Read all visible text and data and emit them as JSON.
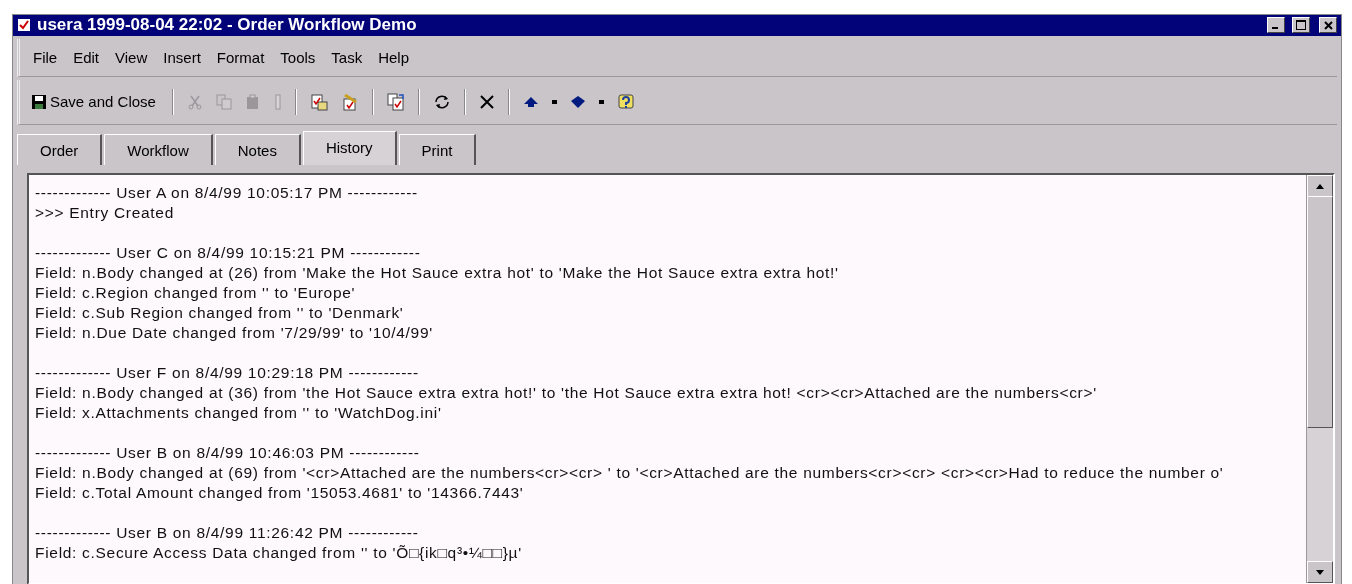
{
  "window": {
    "title": "usera 1999-08-04 22:02 - Order Workflow Demo"
  },
  "menu": [
    "File",
    "Edit",
    "View",
    "Insert",
    "Format",
    "Tools",
    "Task",
    "Help"
  ],
  "toolbar": [
    {
      "kind": "save",
      "label": "Save and Close",
      "disabled": false
    },
    {
      "kind": "sep"
    },
    {
      "kind": "cut",
      "disabled": true
    },
    {
      "kind": "copy",
      "disabled": true
    },
    {
      "kind": "paste",
      "disabled": true
    },
    {
      "kind": "bar",
      "disabled": true
    },
    {
      "kind": "sep"
    },
    {
      "kind": "doc-check",
      "disabled": false
    },
    {
      "kind": "doc-pen",
      "disabled": false
    },
    {
      "kind": "sep"
    },
    {
      "kind": "docs",
      "disabled": false
    },
    {
      "kind": "sep"
    },
    {
      "kind": "refresh",
      "disabled": false
    },
    {
      "kind": "sep"
    },
    {
      "kind": "delete",
      "disabled": false
    },
    {
      "kind": "sep"
    },
    {
      "kind": "up",
      "disabled": false
    },
    {
      "kind": "drop",
      "disabled": false
    },
    {
      "kind": "down",
      "disabled": false
    },
    {
      "kind": "drop",
      "disabled": false
    },
    {
      "kind": "help",
      "disabled": false
    }
  ],
  "tabs": [
    {
      "label": "Order",
      "selected": false
    },
    {
      "label": "Workflow",
      "selected": false
    },
    {
      "label": "Notes",
      "selected": false
    },
    {
      "label": "History",
      "selected": true
    },
    {
      "label": "Print",
      "selected": false
    }
  ],
  "history": [
    {
      "header": "------------- User A on 8/4/99 10:05:17 PM ------------",
      "lines": [
        ">>> Entry Created"
      ]
    },
    {
      "header": "------------- User C on 8/4/99 10:15:21 PM ------------",
      "lines": [
        "Field: n.Body changed at (26) from 'Make the Hot Sauce extra hot' to 'Make the Hot Sauce extra extra hot!'",
        "Field: c.Region changed from '' to 'Europe'",
        "Field: c.Sub Region changed from '' to 'Denmark'",
        "Field: n.Due Date changed from '7/29/99' to '10/4/99'"
      ]
    },
    {
      "header": "------------- User F on 8/4/99 10:29:18 PM ------------",
      "lines": [
        "Field: n.Body changed at (36) from 'the Hot Sauce extra extra hot!' to 'the Hot Sauce extra extra hot! <cr><cr>Attached are the numbers<cr>'",
        "Field: x.Attachments changed from '' to 'WatchDog.ini'"
      ]
    },
    {
      "header": "------------- User B on 8/4/99 10:46:03 PM ------------",
      "lines": [
        "Field: n.Body changed at (69) from '<cr>Attached are the numbers<cr><cr> ' to '<cr>Attached are the numbers<cr><cr> <cr><cr>Had to reduce the number o'",
        "Field: c.Total Amount changed from '15053.4681' to '14366.7443'"
      ]
    },
    {
      "header": "------------- User B on 8/4/99 11:26:42 PM ------------",
      "lines": [
        "Field: c.Secure Access Data changed from '' to 'Õ□{ik□q³•¼□□}µ'"
      ]
    }
  ]
}
